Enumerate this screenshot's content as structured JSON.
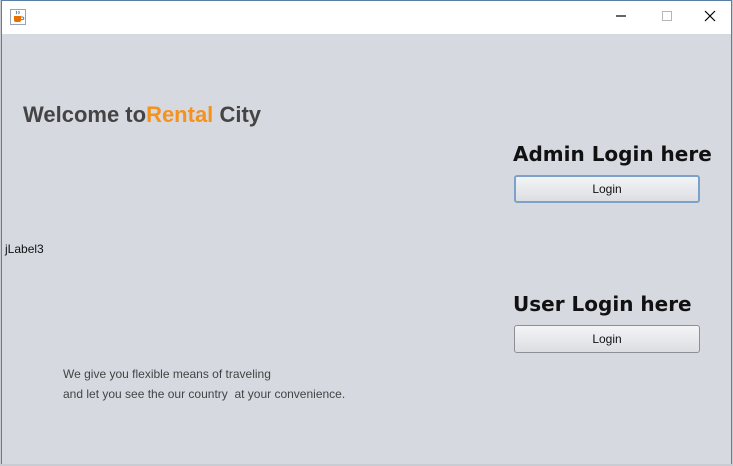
{
  "window": {
    "icon": "java-cup-icon",
    "controls": {
      "minimize": "minimize-icon",
      "maximize": "maximize-icon",
      "close": "close-icon"
    }
  },
  "header": {
    "welcome_prefix": "Welcome to",
    "brand_accent": "Rental",
    "brand_suffix": "City",
    "accent_color": "#f5921e"
  },
  "admin": {
    "title": "Admin Login here",
    "button_label": "Login"
  },
  "user": {
    "title": "User Login here",
    "button_label": "Login"
  },
  "placeholder_label": "jLabel3",
  "tagline": {
    "line1": "We give you flexible means of traveling",
    "line2": "and let you see the our country  at your convenience."
  }
}
